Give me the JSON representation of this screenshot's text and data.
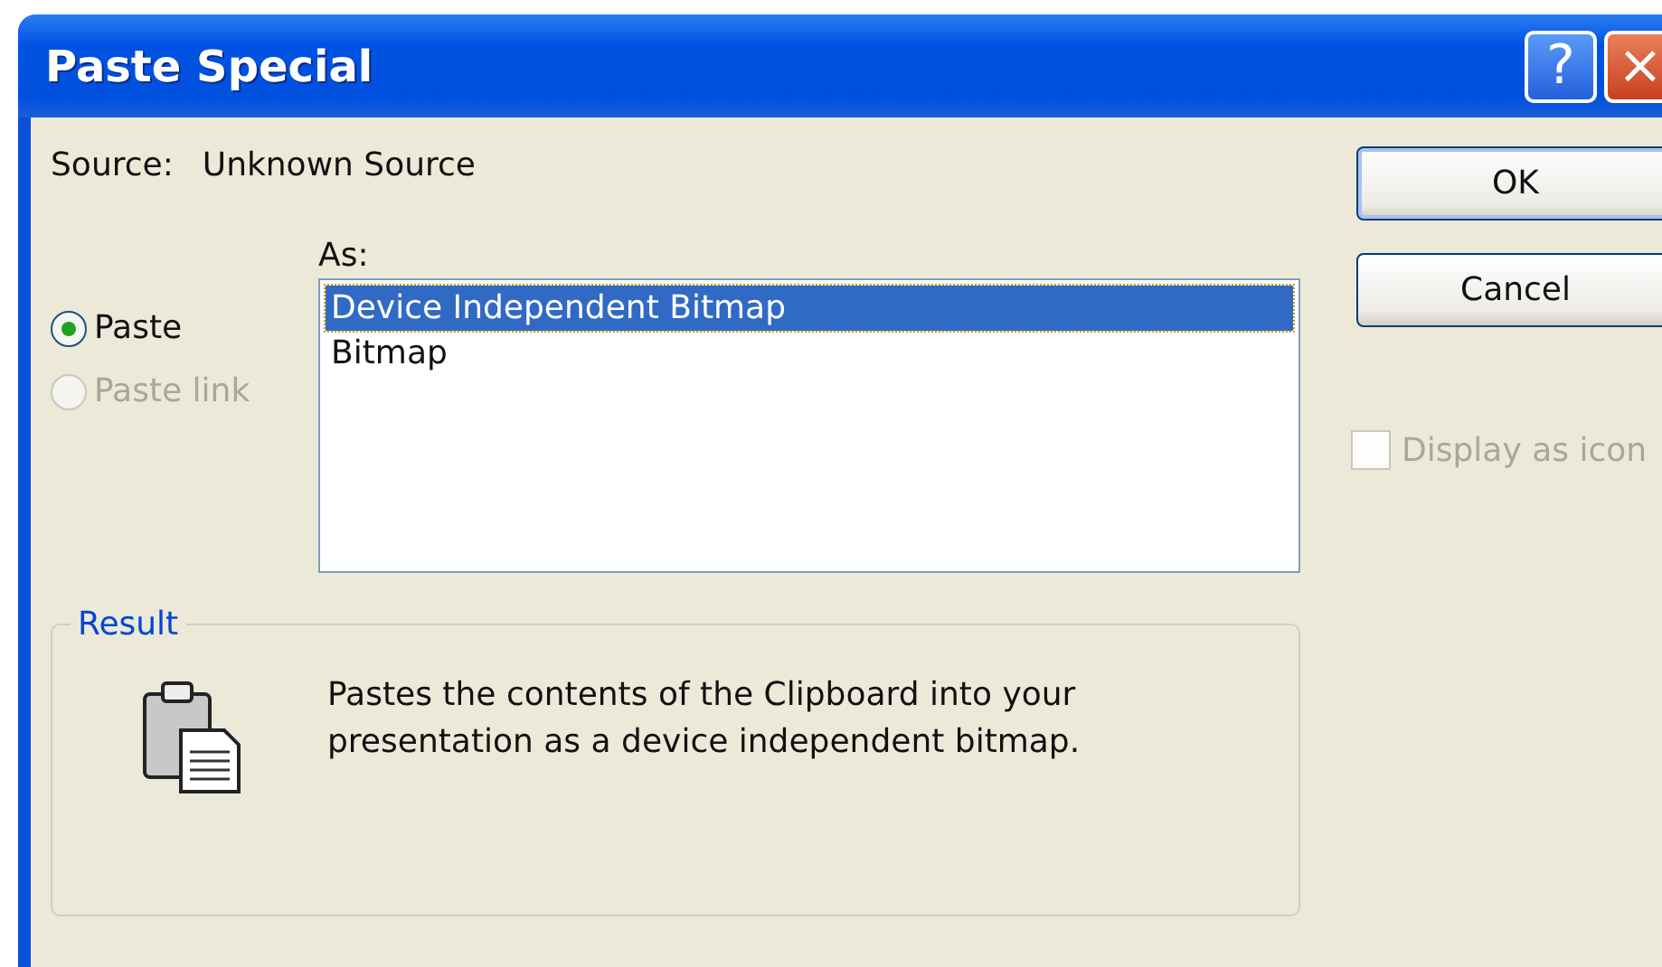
{
  "window": {
    "title": "Paste Special",
    "help_button": "?",
    "close_button": "×"
  },
  "source": {
    "label": "Source:",
    "value": "Unknown Source"
  },
  "as_label": "As:",
  "modes": [
    {
      "label": "Paste",
      "selected": true,
      "disabled": false
    },
    {
      "label": "Paste link",
      "selected": false,
      "disabled": true
    }
  ],
  "formats": [
    {
      "label": "Device Independent Bitmap",
      "selected": true
    },
    {
      "label": "Bitmap",
      "selected": false
    }
  ],
  "buttons": [
    {
      "label": "OK",
      "default": true
    },
    {
      "label": "Cancel",
      "default": false
    }
  ],
  "display_as_icon": {
    "label": "Display as icon",
    "checked": false,
    "disabled": true
  },
  "result": {
    "legend": "Result",
    "text": "Pastes the contents of the Clipboard into your presentation as a device independent bitmap."
  }
}
